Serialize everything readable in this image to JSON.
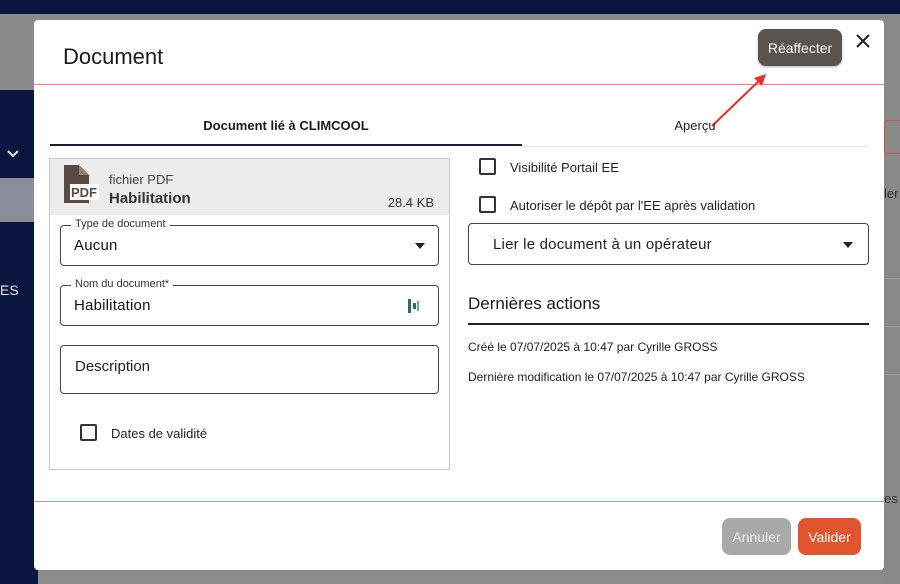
{
  "background": {
    "right_fragment": "ler",
    "left_fragment": "ES",
    "bottom_right_fragment": "es"
  },
  "modal": {
    "title": "Document",
    "reassign_label": "Réaffecter",
    "tabs": [
      {
        "label": "Document lié à CLIMCOOL",
        "active": true
      },
      {
        "label": "Aperçu",
        "active": false
      }
    ],
    "file": {
      "icon": "pdf-file-icon",
      "type": "fichier PDF",
      "name": "Habilitation",
      "size": "28.4 KB"
    },
    "document_type": {
      "label": "Type de document",
      "value": "Aucun"
    },
    "document_name": {
      "label": "Nom du document*",
      "value": "Habilitation"
    },
    "description": {
      "placeholder": "Description"
    },
    "validity_dates_label": "Dates de validité",
    "portal_visibility_label": "Visibilité Portail EE",
    "allow_upload_label": "Autoriser le dépôt par l'EE après validation",
    "operator_select": "Lier le document à un opérateur",
    "last_actions": {
      "title": "Dernières actions",
      "items": [
        "Créé le 07/07/2025 à 10:47 par Cyrille GROSS",
        "Dernière modification le 07/07/2025 à 10:47 par Cyrille GROSS"
      ]
    },
    "cancel_label": "Annuler",
    "submit_label": "Valider"
  },
  "colors": {
    "accent": "#e0542e",
    "navy": "#1a1f3a",
    "reassign_bg": "#5a5450",
    "divider": "#e58a7e"
  }
}
